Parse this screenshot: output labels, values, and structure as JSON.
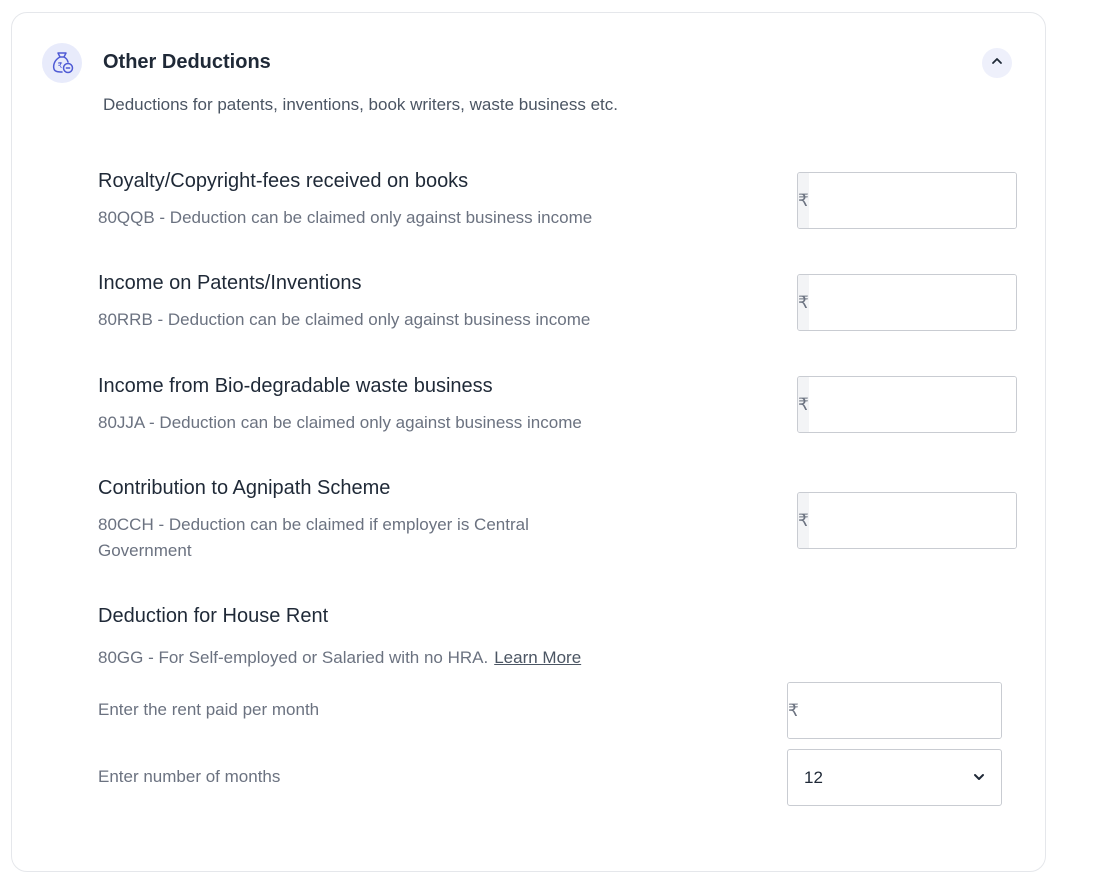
{
  "section": {
    "title": "Other Deductions",
    "subtitle": "Deductions for patents, inventions, book writers, waste business etc."
  },
  "currency_symbol": "₹",
  "items": [
    {
      "title": "Royalty/Copyright-fees received on books",
      "desc": "80QQB - Deduction can be claimed only against business income",
      "value": ""
    },
    {
      "title": "Income on Patents/Inventions",
      "desc": "80RRB - Deduction can be claimed only against business income",
      "value": ""
    },
    {
      "title": "Income from Bio-degradable waste business",
      "desc": "80JJA - Deduction can be claimed only against business income",
      "value": ""
    },
    {
      "title": "Contribution to Agnipath Scheme",
      "desc_line1": "80CCH - Deduction can be claimed if employer is Central",
      "desc_line2": "Government",
      "value": ""
    }
  ],
  "house_rent": {
    "title": "Deduction for House Rent",
    "desc": "80GG - For Self-employed or Salaried with no HRA.",
    "learn_more": "Learn More",
    "rent_label": "Enter the rent paid per month",
    "rent_value": "",
    "months_label": "Enter number of months",
    "months_value": "12"
  },
  "colors": {
    "accent": "#4f5bd5",
    "icon_bg": "#e8ebfb",
    "border": "#c9ccd2"
  },
  "icons": {
    "header": "money-bag-icon",
    "collapse": "chevron-up-icon",
    "select": "chevron-down-icon"
  }
}
